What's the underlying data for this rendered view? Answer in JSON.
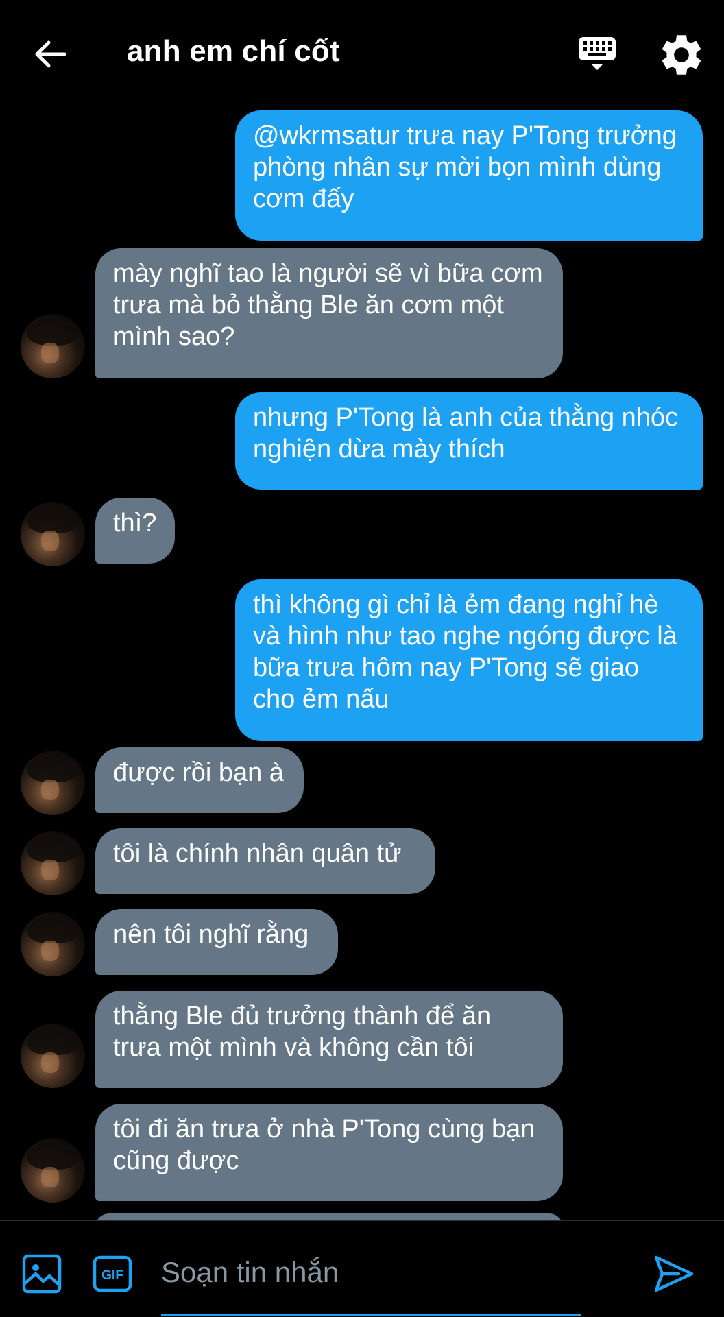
{
  "header": {
    "title": "anh em chí cốt",
    "back_icon": "back-arrow-icon",
    "keyboard_icon": "keyboard-icon",
    "settings_icon": "gear-icon"
  },
  "messages": [
    {
      "direction": "out",
      "text": "@wkrmsatur trưa nay P'Tong trưởng phòng nhân sự mời bọn mình dùng cơm đấy"
    },
    {
      "direction": "in",
      "text": "mày nghĩ tao là người sẽ vì bữa cơm trưa mà bỏ thằng Ble ăn cơm một mình sao?"
    },
    {
      "direction": "out",
      "text": "nhưng P'Tong là anh của thằng nhóc nghiện dừa mày thích"
    },
    {
      "direction": "in",
      "text": "thì?"
    },
    {
      "direction": "out",
      "text": "thì không gì chỉ là ẻm đang nghỉ hè và hình như tao nghe ngóng được là bữa trưa hôm nay P'Tong sẽ giao cho ẻm nấu"
    },
    {
      "direction": "in",
      "text": "được rồi bạn à"
    },
    {
      "direction": "in",
      "text": "tôi là chính nhân quân tử"
    },
    {
      "direction": "in",
      "text": "nên tôi nghĩ rằng"
    },
    {
      "direction": "in",
      "text": "thằng Ble đủ trưởng thành để ăn trưa một mình và không cần tôi"
    },
    {
      "direction": "in",
      "text": "tôi đi ăn trưa ở nhà P'Tong cùng bạn cũng được"
    }
  ],
  "composer": {
    "placeholder": "Soạn tin nhắn",
    "image_icon": "image-icon",
    "gif_label": "GIF",
    "send_icon": "send-icon"
  },
  "colors": {
    "background": "#000000",
    "outgoing_bubble": "#1da1f2",
    "incoming_bubble": "#657786",
    "accent": "#1da1f2"
  }
}
